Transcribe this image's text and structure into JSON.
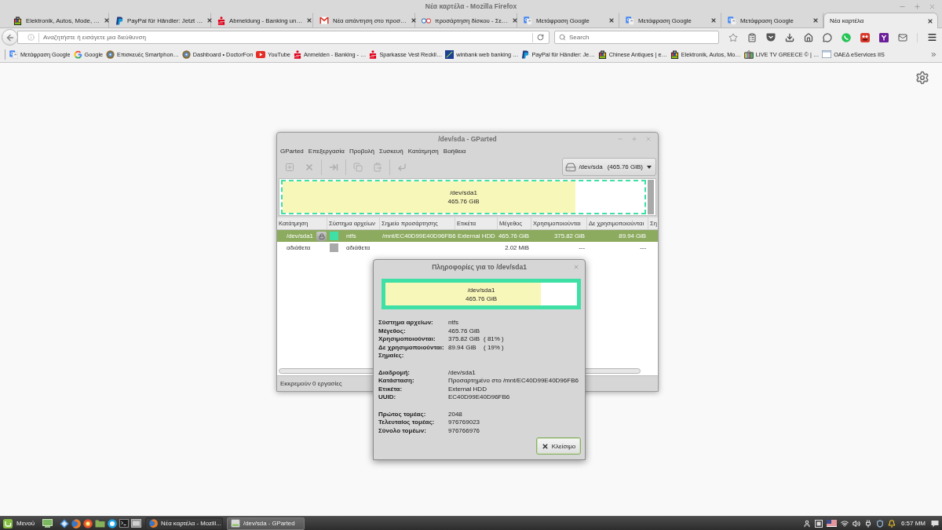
{
  "window": {
    "title": "Νέα καρτέλα - Mozilla Firefox"
  },
  "tabs": [
    {
      "label": "Elektronik, Autos, Mode, …",
      "kind": "shop",
      "selected": false
    },
    {
      "label": "PayPal für Händler: Jetzt …",
      "kind": "payment",
      "selected": false
    },
    {
      "label": "Abmeldung - Banking un…",
      "kind": "bank",
      "selected": false
    },
    {
      "label": "Νέα απάντηση στο προσ…",
      "kind": "mail",
      "selected": false
    },
    {
      "label": "προσάρτηση δίσκου - Σε…",
      "kind": "forum",
      "selected": false
    },
    {
      "label": "Μετάφραση Google",
      "kind": "translate",
      "selected": false
    },
    {
      "label": "Μετάφραση Google",
      "kind": "translate",
      "selected": false
    },
    {
      "label": "Μετάφραση Google",
      "kind": "translate",
      "selected": false
    },
    {
      "label": "Νέα καρτέλα",
      "kind": "blank",
      "selected": true
    }
  ],
  "navbar": {
    "address_placeholder": "Αναζητήστε ή εισάγετε μια διεύθυνση",
    "search_placeholder": "Search"
  },
  "bookmarks": [
    {
      "label": "Μετάφραση Google",
      "kind": "translate"
    },
    {
      "label": "Google",
      "kind": "ring"
    },
    {
      "label": "Επισκευές Smartphon…",
      "kind": "disc"
    },
    {
      "label": "Dashboard • DoctorFon",
      "kind": "disc"
    },
    {
      "label": "YouTube",
      "kind": "video"
    },
    {
      "label": "Anmelden - Banking - …",
      "kind": "bank"
    },
    {
      "label": "Sparkasse Vest Reckli…",
      "kind": "bank"
    },
    {
      "label": "winbank web banking …",
      "kind": "square"
    },
    {
      "label": "PayPal für Händler: Je…",
      "kind": "payment"
    },
    {
      "label": "Chinese Antiques | e…",
      "kind": "shop"
    },
    {
      "label": "Elektronik, Autos, Mo…",
      "kind": "shop"
    },
    {
      "label": "LIVE TV GREECE © | …",
      "kind": "tv"
    },
    {
      "label": "ΟΑΕΔ eServices IIS",
      "kind": "page"
    }
  ],
  "gparted": {
    "title": "/dev/sda - GParted",
    "menu": [
      "GParted",
      "Επεξεργασία",
      "Προβολή",
      "Συσκευή",
      "Κατάτμηση",
      "Βοήθεια"
    ],
    "toolbar": [
      [
        {
          "kind": "new",
          "disabled": true
        },
        {
          "kind": "delete",
          "disabled": true
        }
      ],
      [
        {
          "kind": "resize",
          "disabled": true
        }
      ],
      [
        {
          "kind": "copy",
          "disabled": true
        },
        {
          "kind": "paste",
          "disabled": true
        }
      ],
      [
        {
          "kind": "undo",
          "disabled": true
        }
      ]
    ],
    "device": {
      "name": "/dev/sda",
      "size": "(465.76 GiB)"
    },
    "disk_map": [
      {
        "kind": "partition",
        "name": "/dev/sda1",
        "size": "465.76 GiB",
        "level": 0.81,
        "color": "#3ee0a5",
        "selected": true
      },
      {
        "kind": "unallocated",
        "color": "#a9a9a9",
        "selected": false
      }
    ],
    "columns": [
      "Κατάτμηση",
      "Σύστημα αρχείων",
      "Σημείο προσάρτησης",
      "Ετικέτα",
      "Μέγεθος",
      "Χρησιμοποιούνται",
      "Δε χρησιμοποιούνται",
      "Ση"
    ],
    "rows": [
      {
        "partition": "/dev/sda1",
        "mounted": true,
        "color": "#3ee0a5",
        "filesystem": "ntfs",
        "mount_point": "/mnt/EC40D99E40D96FB6",
        "label": "External HDD",
        "size": "465.76 GiB",
        "used": "375.82 GiB",
        "unused": "89.94 GiB",
        "selected": true
      },
      {
        "partition": "αδιάθετα",
        "mounted": false,
        "color": "#a9a9a9",
        "filesystem": "αδιάθετα",
        "size": "2.02 MiB",
        "used": "---",
        "unused": "---",
        "selected": false
      }
    ],
    "status": "Εκκρεμούν 0 εργασίες"
  },
  "dialog": {
    "title": "Πληροφορίες για το /dev/sda1",
    "bar": {
      "name": "/dev/sda1",
      "size": "465.76 GiB",
      "level": 0.81,
      "color": "#3ee0a5"
    },
    "groups": [
      [
        {
          "label": "Σύστημα αρχείων:",
          "value": "ntfs"
        },
        {
          "label": "Μέγεθος:",
          "value": "465.76 GiB"
        },
        {
          "label": "Χρησιμοποιούνται:",
          "value": "375.82 GiB",
          "percent": "( 81% )"
        },
        {
          "label": "Δε χρησιμοποιούνται:",
          "value": "89.94 GiB",
          "percent": "( 19% )"
        },
        {
          "label": "Σημαίες:"
        }
      ],
      [
        {
          "label": "Διαδρομή:",
          "value": "/dev/sda1"
        },
        {
          "label": "Κατάσταση:",
          "value": "Προσαρτημένο στο /mnt/EC40D99E40D96FB6"
        },
        {
          "label": "Ετικέτα:",
          "value": "External HDD"
        },
        {
          "label": "UUID:",
          "value": "EC40D99E40D96FB6"
        }
      ],
      [
        {
          "label": "Πρώτος τομέας:",
          "value": "2048"
        },
        {
          "label": "Τελευταίος τομέας:",
          "value": "976769023"
        },
        {
          "label": "Σύνολο τομέων:",
          "value": "976766976"
        }
      ]
    ],
    "close_button": "Κλείσιμο"
  },
  "taskbar": {
    "menu_label": "Μενού",
    "windows": [
      {
        "label": "Νέα καρτέλα - Mozill...",
        "kind": "browser",
        "selected": false
      },
      {
        "label": "/dev/sda - GParted",
        "kind": "disk",
        "selected": true
      }
    ],
    "clock": "6:57 ΜΜ"
  }
}
